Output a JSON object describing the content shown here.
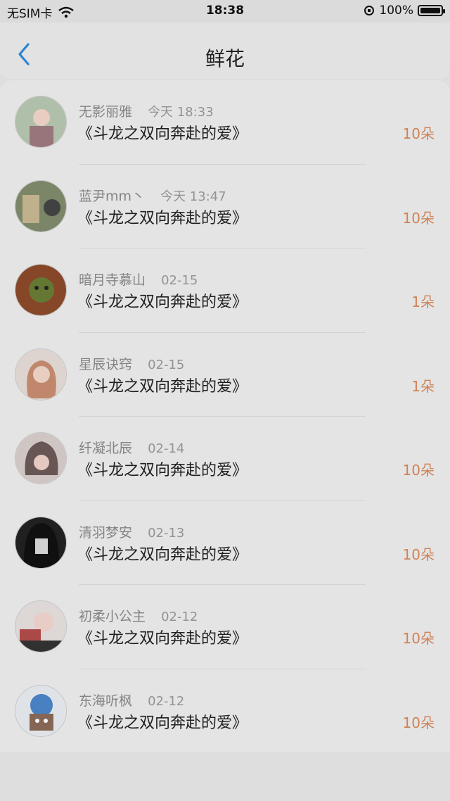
{
  "status_bar": {
    "carrier": "无SIM卡",
    "time": "18:38",
    "battery": "100%"
  },
  "nav": {
    "title": "鲜花"
  },
  "items": [
    {
      "user": "无影丽雅",
      "time": "今天 18:33",
      "book": "《斗龙之双向奔赴的爱》",
      "count": "10朵",
      "avatar_color": "#b8c7b0"
    },
    {
      "user": "蓝尹mm丶",
      "time": "今天 13:47",
      "book": "《斗龙之双向奔赴的爱》",
      "count": "10朵",
      "avatar_color": "#7f8c6c"
    },
    {
      "user": "暗月寺慕山",
      "time": "02-15",
      "book": "《斗龙之双向奔赴的爱》",
      "count": "1朵",
      "avatar_color": "#8c4a2b"
    },
    {
      "user": "星辰诀窍",
      "time": "02-15",
      "book": "《斗龙之双向奔赴的爱》",
      "count": "1朵",
      "avatar_color": "#c98d71"
    },
    {
      "user": "纤凝北辰",
      "time": "02-14",
      "book": "《斗龙之双向奔赴的爱》",
      "count": "10朵",
      "avatar_color": "#6c5a58"
    },
    {
      "user": "清羽梦安",
      "time": "02-13",
      "book": "《斗龙之双向奔赴的爱》",
      "count": "10朵",
      "avatar_color": "#333333"
    },
    {
      "user": "初柔小公主",
      "time": "02-12",
      "book": "《斗龙之双向奔赴的爱》",
      "count": "10朵",
      "avatar_color": "#b24c4c"
    },
    {
      "user": "东海听枫",
      "time": "02-12",
      "book": "《斗龙之双向奔赴的爱》",
      "count": "10朵",
      "avatar_color": "#4d86c9"
    }
  ],
  "colors": {
    "accent": "#2c8bdc",
    "flower_count": "#d9885b"
  }
}
